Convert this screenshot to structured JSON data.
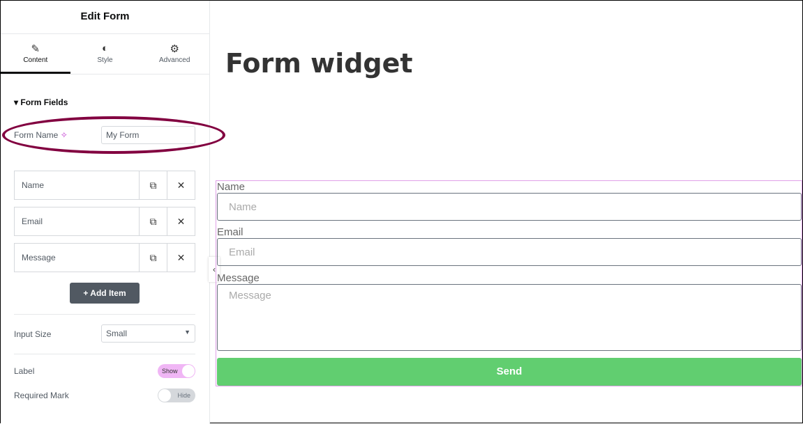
{
  "panel": {
    "title": "Edit Form",
    "tabs": [
      {
        "label": "Content",
        "icon": "pencil-icon"
      },
      {
        "label": "Style",
        "icon": "contrast-icon"
      },
      {
        "label": "Advanced",
        "icon": "gear-icon"
      }
    ],
    "section": "Form Fields",
    "form_name_label": "Form Name",
    "form_name_value": "My Form",
    "fields": [
      "Name",
      "Email",
      "Message"
    ],
    "add_item": "Add Item",
    "input_size_label": "Input Size",
    "input_size_value": "Small",
    "label_label": "Label",
    "label_toggle": "Show",
    "required_label": "Required Mark",
    "required_toggle": "Hide"
  },
  "canvas": {
    "heading": "Form widget",
    "fields": [
      {
        "label": "Name",
        "placeholder": "Name"
      },
      {
        "label": "Email",
        "placeholder": "Email"
      },
      {
        "label": "Message",
        "placeholder": "Message"
      }
    ],
    "submit": "Send"
  },
  "colors": {
    "accent": "#61ce70",
    "highlight": "#820040"
  }
}
